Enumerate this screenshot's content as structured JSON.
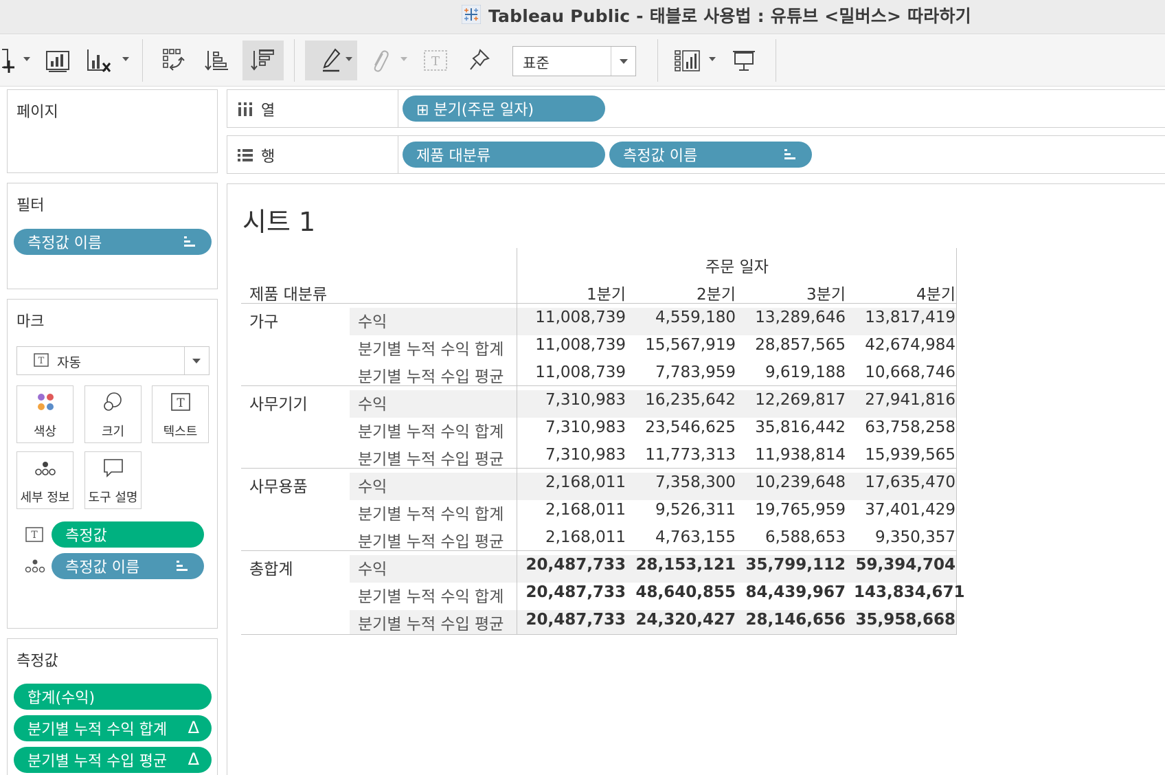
{
  "window": {
    "title": "Tableau Public - 태블로 사용법 : 유튜브 <밀버스> 따라하기",
    "app_icon": "tableau-logo-icon"
  },
  "toolbar": {
    "icons": [
      "add-datasource-icon",
      "new-worksheet-icon",
      "clear-sheet-icon",
      "swap-rows-columns-icon",
      "sort-ascending-icon",
      "sort-descending-icon",
      "highlight-pen-icon",
      "group-paperclip-icon",
      "show-labels-icon",
      "fix-axes-pin-icon",
      "show-me-icon",
      "presentation-mode-icon"
    ],
    "fit_label": "표준"
  },
  "pages_panel": {
    "title": "페이지"
  },
  "filters_panel": {
    "title": "필터",
    "pills": [
      {
        "label": "측정값 이름"
      }
    ]
  },
  "marks_panel": {
    "title": "마크",
    "mark_type": "자동",
    "cards": [
      {
        "label": "색상",
        "icon": "color-dots-icon"
      },
      {
        "label": "크기",
        "icon": "size-circles-icon"
      },
      {
        "label": "텍스트",
        "icon": "text-t-icon"
      },
      {
        "label": "세부 정보",
        "icon": "detail-dots-icon"
      },
      {
        "label": "도구 설명",
        "icon": "tooltip-bubble-icon"
      }
    ],
    "encodings": [
      {
        "label": "측정값",
        "icon": "text-t-icon",
        "color": "#00b180"
      },
      {
        "label": "측정값 이름",
        "icon": "detail-dots-icon",
        "color": "#4d98b5"
      }
    ]
  },
  "measure_values_panel": {
    "title": "측정값",
    "pills": [
      {
        "label": "합계(수익)"
      },
      {
        "label": "분기별 누적 수익 합계",
        "suffix": "Δ"
      },
      {
        "label": "분기별 누적 수입 평균",
        "suffix": "Δ"
      }
    ]
  },
  "shelves": {
    "columns": {
      "label": "열",
      "pills": [
        {
          "label": "⊞ 분기(주문 일자)"
        }
      ]
    },
    "rows": {
      "label": "행",
      "pills": [
        {
          "label": "제품 대분류"
        },
        {
          "label": "측정값 이름"
        }
      ]
    }
  },
  "sheet": {
    "title": "시트 1",
    "column_group_header": "주문 일자",
    "row_header": "제품 대분류",
    "quarters": [
      "1분기",
      "2분기",
      "3분기",
      "4분기"
    ],
    "groups": [
      {
        "name": "가구",
        "rows": [
          {
            "measure": "수익",
            "values": [
              "11,008,739",
              "4,559,180",
              "13,289,646",
              "13,817,419"
            ]
          },
          {
            "measure": "분기별 누적 수익 합계",
            "values": [
              "11,008,739",
              "15,567,919",
              "28,857,565",
              "42,674,984"
            ]
          },
          {
            "measure": "분기별 누적 수입 평균",
            "values": [
              "11,008,739",
              "7,783,959",
              "9,619,188",
              "10,668,746"
            ]
          }
        ]
      },
      {
        "name": "사무기기",
        "rows": [
          {
            "measure": "수익",
            "values": [
              "7,310,983",
              "16,235,642",
              "12,269,817",
              "27,941,816"
            ]
          },
          {
            "measure": "분기별 누적 수익 합계",
            "values": [
              "7,310,983",
              "23,546,625",
              "35,816,442",
              "63,758,258"
            ]
          },
          {
            "measure": "분기별 누적 수입 평균",
            "values": [
              "7,310,983",
              "11,773,313",
              "11,938,814",
              "15,939,565"
            ]
          }
        ]
      },
      {
        "name": "사무용품",
        "rows": [
          {
            "measure": "수익",
            "values": [
              "2,168,011",
              "7,358,300",
              "10,239,648",
              "17,635,470"
            ]
          },
          {
            "measure": "분기별 누적 수익 합계",
            "values": [
              "2,168,011",
              "9,526,311",
              "19,765,959",
              "37,401,429"
            ]
          },
          {
            "measure": "분기별 누적 수입 평균",
            "values": [
              "2,168,011",
              "4,763,155",
              "6,588,653",
              "9,350,357"
            ]
          }
        ]
      },
      {
        "name": "총합계",
        "grand_total": true,
        "rows": [
          {
            "measure": "수익",
            "values": [
              "20,487,733",
              "28,153,121",
              "35,799,112",
              "59,394,704"
            ]
          },
          {
            "measure": "분기별 누적 수익 합계",
            "values": [
              "20,487,733",
              "48,640,855",
              "84,439,967",
              "143,834,671"
            ]
          },
          {
            "measure": "분기별 누적 수입 평균",
            "values": [
              "20,487,733",
              "24,320,427",
              "28,146,656",
              "35,958,668"
            ]
          }
        ]
      }
    ]
  },
  "colors": {
    "dimension_pill": "#4d98b5",
    "measure_pill": "#00b180",
    "band": "#f1f1f1",
    "toolbar_bg": "#f5f5f5",
    "titlebar_bg": "#ececec"
  }
}
